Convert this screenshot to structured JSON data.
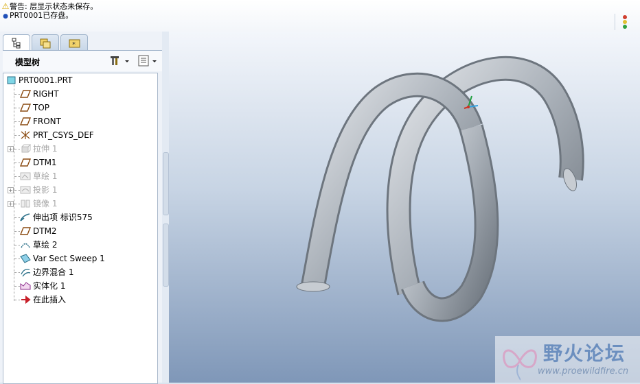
{
  "messages": [
    {
      "icon": "warning-icon",
      "text": "警告: 层显示状态未保存。"
    },
    {
      "icon": "info-dot-icon",
      "text": "PRT0001已存盘。"
    }
  ],
  "model_tree": {
    "title": "模型树",
    "items": [
      {
        "label": "PRT0001.PRT",
        "icon": "part-icon",
        "state": "normal"
      },
      {
        "label": "RIGHT",
        "icon": "datum-plane-icon",
        "state": "normal"
      },
      {
        "label": "TOP",
        "icon": "datum-plane-icon",
        "state": "normal"
      },
      {
        "label": "FRONT",
        "icon": "datum-plane-icon",
        "state": "normal"
      },
      {
        "label": "PRT_CSYS_DEF",
        "icon": "csys-icon",
        "state": "normal"
      },
      {
        "label": "拉伸 1",
        "icon": "extrude-icon",
        "state": "suppressed",
        "expandable": true
      },
      {
        "label": "DTM1",
        "icon": "datum-plane-icon",
        "state": "normal"
      },
      {
        "label": "草绘 1",
        "icon": "sketch-icon",
        "state": "suppressed"
      },
      {
        "label": "投影 1",
        "icon": "projection-icon",
        "state": "suppressed",
        "expandable": true
      },
      {
        "label": "镜像 1",
        "icon": "mirror-icon",
        "state": "suppressed",
        "expandable": true
      },
      {
        "label": "伸出项 标识575",
        "icon": "protrusion-icon",
        "state": "normal"
      },
      {
        "label": "DTM2",
        "icon": "datum-plane-icon",
        "state": "normal"
      },
      {
        "label": "草绘 2",
        "icon": "sketch-icon",
        "state": "normal"
      },
      {
        "label": "Var Sect Sweep 1",
        "icon": "sweep-icon",
        "state": "normal"
      },
      {
        "label": "边界混合 1",
        "icon": "boundary-blend-icon",
        "state": "normal"
      },
      {
        "label": "实体化 1",
        "icon": "solidify-icon",
        "state": "normal"
      },
      {
        "label": "在此插入",
        "icon": "insert-here-arrow-icon",
        "state": "normal"
      }
    ]
  },
  "watermark": {
    "title": "野火论坛",
    "url": "www.proewildfire.cn"
  },
  "colors": {
    "accent": "#1f4fb8",
    "warning": "#d8a800",
    "tube": "#a9b0b8"
  }
}
